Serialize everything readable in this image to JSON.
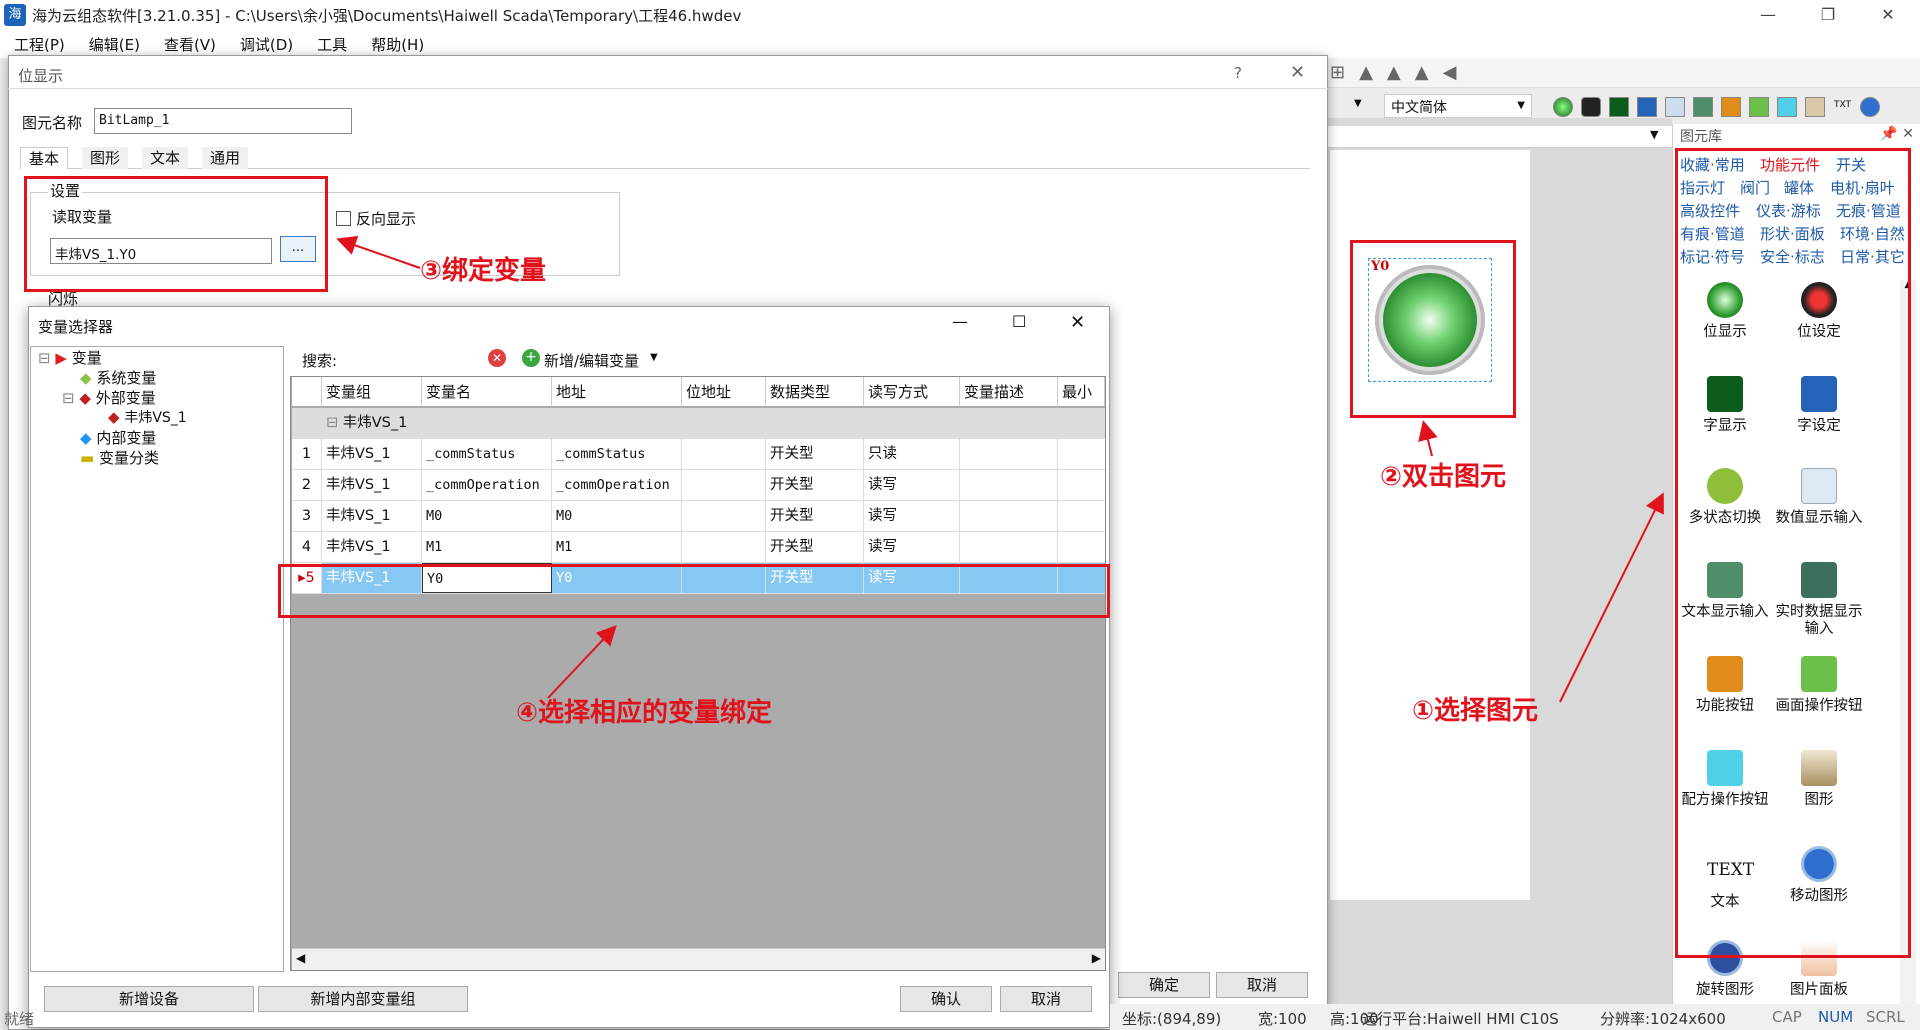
{
  "app": {
    "title": "海为云组态软件[3.21.0.35] - C:\\Users\\余小强\\Documents\\Haiwell Scada\\Temporary\\工程46.hwdev",
    "icon": "app-logo-icon"
  },
  "menu": [
    "工程(P)",
    "编辑(E)",
    "查看(V)",
    "调试(D)",
    "工具",
    "帮助(H)"
  ],
  "toolbar": {
    "language": "中文简体"
  },
  "library": {
    "title": "图元库",
    "categories": [
      [
        "收藏·常用",
        "功能元件",
        "开关"
      ],
      [
        "指示灯",
        "阀门",
        "罐体",
        "电机·扇叶"
      ],
      [
        "高级控件",
        "仪表·游标",
        "无痕·管道"
      ],
      [
        "有痕·管道",
        "形状·面板",
        "环境·自然"
      ],
      [
        "标记·符号",
        "安全·标志",
        "日常·其它"
      ]
    ],
    "items": [
      {
        "label": "位显示",
        "icon": "bit-lamp-icon"
      },
      {
        "label": "位设定",
        "icon": "bit-set-icon"
      },
      {
        "label": "字显示",
        "icon": "word-display-icon"
      },
      {
        "label": "字设定",
        "icon": "word-set-icon"
      },
      {
        "label": "多状态切换",
        "icon": "multistate-switch-icon"
      },
      {
        "label": "数值显示输入",
        "icon": "numeric-input-icon"
      },
      {
        "label": "文本显示输入",
        "icon": "text-input-icon"
      },
      {
        "label": "实时数据显示输入",
        "icon": "realtime-data-icon"
      },
      {
        "label": "功能按钮",
        "icon": "function-button-icon"
      },
      {
        "label": "画面操作按钮",
        "icon": "screen-button-icon"
      },
      {
        "label": "配方操作按钮",
        "icon": "recipe-button-icon"
      },
      {
        "label": "图形",
        "icon": "image-icon"
      },
      {
        "label": "文本",
        "icon": "text-icon",
        "glyph": "TEXT"
      },
      {
        "label": "移动图形",
        "icon": "move-graphic-icon"
      },
      {
        "label": "旋转图形",
        "icon": "rotate-graphic-icon"
      },
      {
        "label": "图片面板",
        "icon": "picture-panel-icon"
      }
    ]
  },
  "canvas": {
    "lamp_label": "Y0"
  },
  "dialog1": {
    "title": "位显示",
    "help": "?",
    "element_name_label": "图元名称",
    "element_name_value": "BitLamp_1",
    "tabs": [
      "基本",
      "图形",
      "文本",
      "通用"
    ],
    "group_title": "设置",
    "read_var_label": "读取变量",
    "read_var_value": "丰炜VS_1.Y0",
    "browse_label": "...",
    "reverse_label": "反向显示",
    "blink_label": "闪烁",
    "ok": "确定",
    "cancel": "取消"
  },
  "dialog2": {
    "title": "变量选择器",
    "tree": [
      {
        "label": "变量",
        "icon": "variable-root-icon"
      },
      {
        "label": "系统变量",
        "icon": "system-var-icon"
      },
      {
        "label": "外部变量",
        "icon": "external-var-icon"
      },
      {
        "label": "丰炜VS_1",
        "icon": "device-icon"
      },
      {
        "label": "内部变量",
        "icon": "internal-var-icon"
      },
      {
        "label": "变量分类",
        "icon": "folder-icon"
      }
    ],
    "search_label": "搜索:",
    "add_edit_label": "新增/编辑变量",
    "columns": [
      "变量组",
      "变量名",
      "地址",
      "位地址",
      "数据类型",
      "读写方式",
      "变量描述",
      "最小值"
    ],
    "group_row": "丰炜VS_1",
    "rows": [
      {
        "no": "1",
        "group": "丰炜VS_1",
        "name": "_commStatus",
        "addr": "_commStatus",
        "bit": "",
        "type": "开关型",
        "rw": "只读",
        "desc": ""
      },
      {
        "no": "2",
        "group": "丰炜VS_1",
        "name": "_commOperation",
        "addr": "_commOperation",
        "bit": "",
        "type": "开关型",
        "rw": "读写",
        "desc": ""
      },
      {
        "no": "3",
        "group": "丰炜VS_1",
        "name": "M0",
        "addr": "M0",
        "bit": "",
        "type": "开关型",
        "rw": "读写",
        "desc": ""
      },
      {
        "no": "4",
        "group": "丰炜VS_1",
        "name": "M1",
        "addr": "M1",
        "bit": "",
        "type": "开关型",
        "rw": "读写",
        "desc": ""
      },
      {
        "no": "5",
        "group": "丰炜VS_1",
        "name": "Y0",
        "addr": "Y0",
        "bit": "",
        "type": "开关型",
        "rw": "读写",
        "desc": ""
      }
    ],
    "add_device": "新增设备",
    "add_internal_group": "新增内部变量组",
    "confirm": "确认",
    "cancel": "取消"
  },
  "annotations": {
    "step1": "①选择图元",
    "step2": "②双击图元",
    "step3": "③绑定变量",
    "step4": "④选择相应的变量绑定"
  },
  "status": {
    "left": "就绪",
    "coord": "坐标:(894,89)",
    "width": "宽:100",
    "height": "高:100",
    "platform": "运行平台:Haiwell HMI C10S",
    "resolution": "分辨率:1024x600",
    "cap": "CAP",
    "num": "NUM",
    "scrl": "SCRL"
  },
  "colors": {
    "annotation": "#e0121b",
    "link": "#1e5aa8",
    "selected_row": "#86c8f2"
  }
}
